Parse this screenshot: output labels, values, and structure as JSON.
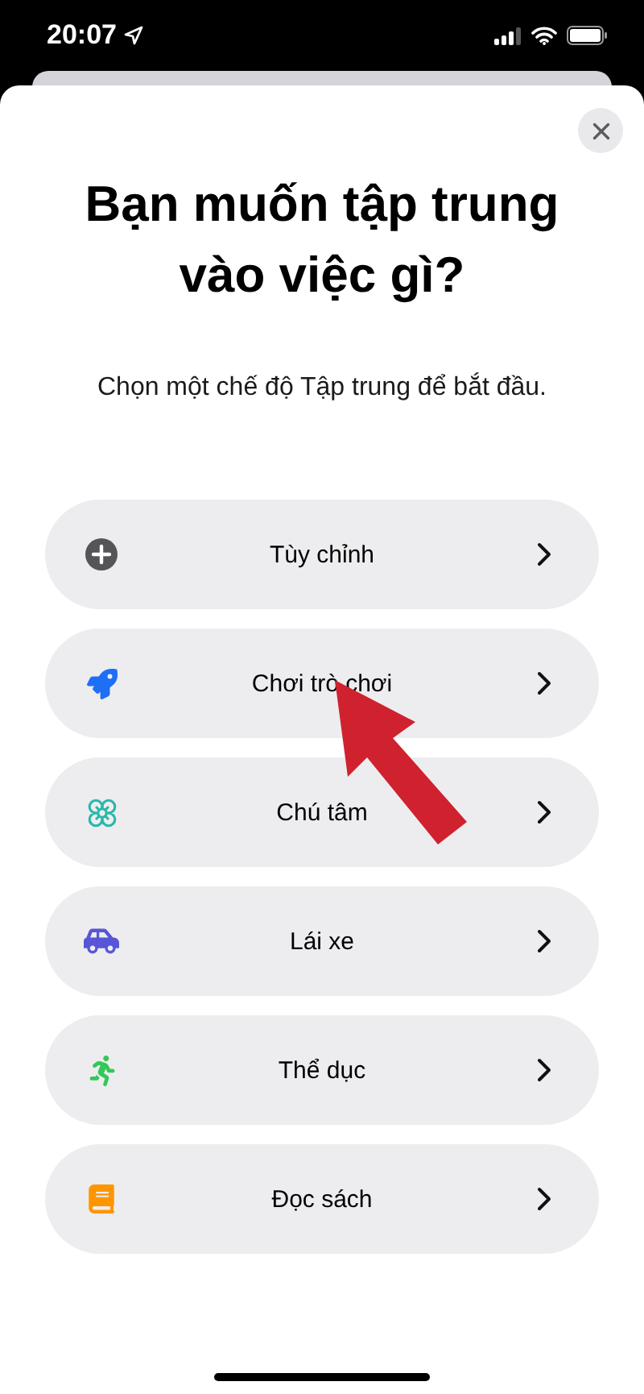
{
  "status_bar": {
    "time": "20:07"
  },
  "title": "Bạn muốn tập trung vào việc gì?",
  "subtitle": "Chọn một chế độ Tập trung để bắt đầu.",
  "options": [
    {
      "label": "Tùy chỉnh",
      "kind": "plus",
      "color": "#555558"
    },
    {
      "label": "Chơi trò chơi",
      "kind": "rocket",
      "color": "#1e6ff5"
    },
    {
      "label": "Chú tâm",
      "kind": "flower",
      "color": "#2ab8a8"
    },
    {
      "label": "Lái xe",
      "kind": "car",
      "color": "#5856d6"
    },
    {
      "label": "Thể dục",
      "kind": "runner",
      "color": "#34c759"
    },
    {
      "label": "Đọc sách",
      "kind": "book",
      "color": "#ff9500"
    }
  ]
}
